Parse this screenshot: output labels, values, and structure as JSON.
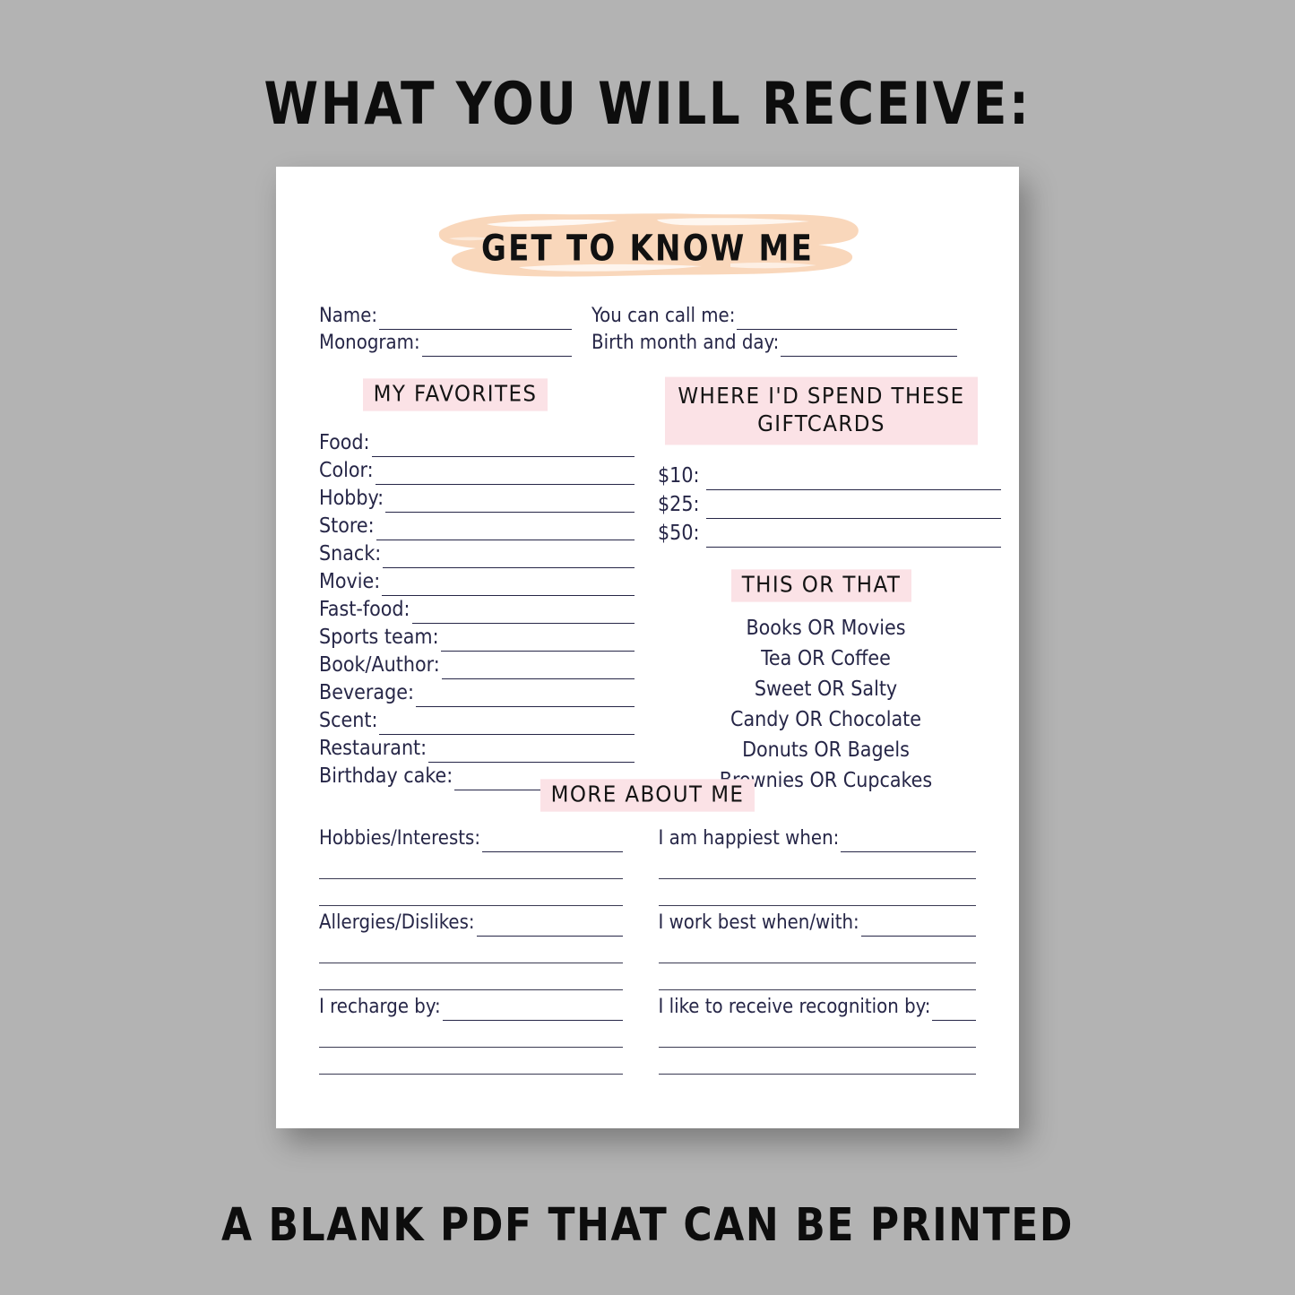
{
  "promo": {
    "title": "WHAT YOU WILL RECEIVE:",
    "caption": "A BLANK PDF THAT CAN BE PRINTED"
  },
  "colors": {
    "page_background": "#b3b3b3",
    "sheet": "#ffffff",
    "brush_peach": "#f9d7bb",
    "highlight_pink": "#fbe2e6",
    "ink_navy": "#262647",
    "promo_ink": "#0d0d0d"
  },
  "sheet": {
    "banner_title": "GET TO KNOW ME",
    "identity": {
      "left": [
        {
          "label": "Name:"
        },
        {
          "label": "Monogram:"
        }
      ],
      "right": [
        {
          "label": "You can call me:"
        },
        {
          "label": "Birth month and day:"
        }
      ]
    },
    "favorites": {
      "heading": "MY FAVORITES",
      "items": [
        {
          "label": "Food:"
        },
        {
          "label": "Color:"
        },
        {
          "label": "Hobby:"
        },
        {
          "label": "Store:"
        },
        {
          "label": "Snack:"
        },
        {
          "label": "Movie:"
        },
        {
          "label": "Fast-food:"
        },
        {
          "label": "Sports team:"
        },
        {
          "label": "Book/Author:"
        },
        {
          "label": "Beverage:"
        },
        {
          "label": "Scent:"
        },
        {
          "label": "Restaurant:"
        },
        {
          "label": "Birthday cake:"
        }
      ]
    },
    "giftcards": {
      "heading_line1": "WHERE I'D SPEND THESE",
      "heading_line2": "GIFTCARDS",
      "items": [
        {
          "label": "$10:"
        },
        {
          "label": "$25:"
        },
        {
          "label": "$50:"
        }
      ]
    },
    "this_or_that": {
      "heading": "THIS OR THAT",
      "items": [
        "Books OR Movies",
        "Tea OR Coffee",
        "Sweet OR Salty",
        "Candy OR Chocolate",
        "Donuts OR Bagels",
        "Brownies OR Cupcakes"
      ]
    },
    "more_about_me": {
      "heading": "MORE ABOUT ME",
      "left": [
        {
          "label": "Hobbies/Interests:",
          "blank_lines": 2
        },
        {
          "label": "Allergies/Dislikes:",
          "blank_lines": 2
        },
        {
          "label": "I recharge by:",
          "blank_lines": 2
        }
      ],
      "right": [
        {
          "label": "I am happiest when:",
          "blank_lines": 2
        },
        {
          "label": "I work best when/with:",
          "blank_lines": 2
        },
        {
          "label": "I like to receive recognition by:",
          "blank_lines": 2
        }
      ]
    }
  }
}
